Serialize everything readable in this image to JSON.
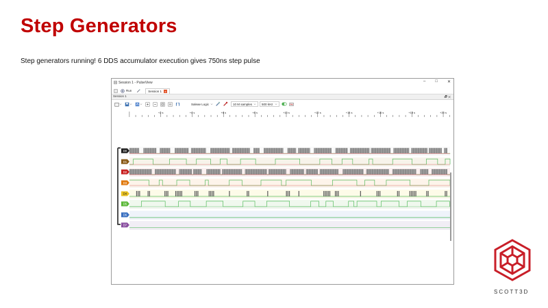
{
  "slide": {
    "title": "Step Generators",
    "body": "Step generators running! 6 DDS accumulator execution gives 750ns step pulse"
  },
  "window": {
    "title": "Session 1 - PulseView",
    "controls": [
      "–",
      "□",
      "✕"
    ],
    "run_label": "Run",
    "tab_label": "Session 1",
    "session_bar_label": "Session 1",
    "dock_controls": "🗗 ✕",
    "device": "Saleae Logic",
    "samples": "10 M samples",
    "rate": "500 kHz",
    "ruler_ticks": [
      "+2 s",
      "+4 s",
      "+6 s",
      "+8 s",
      "+10 s",
      "+12 s",
      "+14 s",
      "+16 s",
      "+18 s",
      "+20 s"
    ],
    "channels": [
      {
        "label": "D0",
        "color": "#222222",
        "text_color": "#ffffff"
      },
      {
        "label": "D1",
        "color": "#8a5a16",
        "text_color": "#ffffff"
      },
      {
        "label": "D2",
        "color": "#c82020",
        "text_color": "#ffffff"
      },
      {
        "label": "D3",
        "color": "#e07a10",
        "text_color": "#ffffff"
      },
      {
        "label": "D4",
        "color": "#e8c020",
        "text_color": "#222222"
      },
      {
        "label": "D5",
        "color": "#5cb83a",
        "text_color": "#ffffff"
      },
      {
        "label": "D6",
        "color": "#3a70c0",
        "text_color": "#ffffff"
      },
      {
        "label": "D7",
        "color": "#8a50a0",
        "text_color": "#ffffff"
      }
    ]
  },
  "logo": {
    "text": "SCOTT3D",
    "color": "#c81e28"
  }
}
